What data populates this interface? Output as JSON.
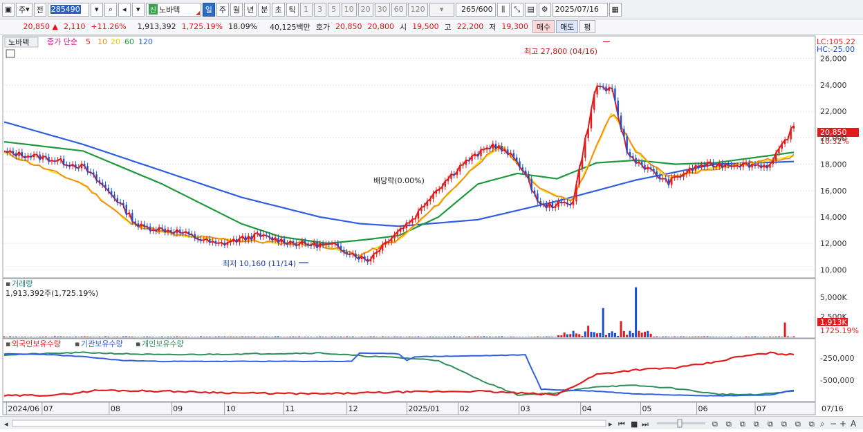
{
  "toolbar": {
    "period_main": "주",
    "prefix": "전",
    "code": "285490",
    "badge": "신",
    "name": "노바텍",
    "tabs": [
      "일",
      "주",
      "월",
      "년",
      "분",
      "초",
      "틱"
    ],
    "active_tab": "일",
    "intervals": [
      "1",
      "3",
      "5",
      "10",
      "20",
      "30",
      "60",
      "120"
    ],
    "count": "265",
    "count_total": "/600",
    "date": "2025/07/16"
  },
  "quote": {
    "price": "20,850",
    "change_arrow": "▲",
    "change": "2,110",
    "change_pct": "+11.26%",
    "volume": "1,913,392",
    "volume_pct": "1,725.19%",
    "turnover": "18.09%",
    "amount": "40,125백만",
    "ask_label": "호가",
    "ask": "20,850",
    "bid": "20,800",
    "open_label": "시",
    "open": "19,500",
    "high_label": "고",
    "high": "22,200",
    "low_label": "저",
    "low": "19,300",
    "buy": "매수",
    "sell": "매도",
    "eval": "평"
  },
  "price_panel": {
    "title": "노바텍",
    "legend_prefix": "종가 단순",
    "ma_labels": [
      "5",
      "10",
      "20",
      "60",
      "120"
    ],
    "ma_colors": [
      "#e21c1c",
      "#f08a1a",
      "#f5e11a",
      "#1e9a3c",
      "#2f5fe0"
    ],
    "lc": "LC:105.22",
    "hc": "HC:-25.00",
    "high_note": "최고 27,800 (04/16)",
    "low_note": "최저 10,160 (11/14)",
    "dividend_note": "배당락(0.00%)",
    "current_tag": "20,850",
    "current_pct": "10.32%",
    "y_ticks": [
      "26,000",
      "24,000",
      "22,000",
      "20,000",
      "18,000",
      "16,000",
      "14,000",
      "12,000",
      "10,000"
    ]
  },
  "volume_panel": {
    "title": "거래량",
    "subtitle": "1,913,392주(1,725.19%)",
    "y_ticks": [
      "5,000K",
      "2,500K"
    ],
    "current_tag": "1,913K",
    "current_pct": "1725.19%"
  },
  "holding_panel": {
    "legend": [
      "외국인보유수량",
      "기관보유수량",
      "개인보유수량"
    ],
    "legend_colors": [
      "#e21c1c",
      "#2f5fe0",
      "#2e8f5a"
    ],
    "y_ticks": [
      "-250,000",
      "-500,000"
    ]
  },
  "x_axis": {
    "labels": [
      "2024/06",
      "07",
      "08",
      "09",
      "10",
      "11",
      "12",
      "2025/01",
      "02",
      "03",
      "04",
      "05",
      "06",
      "07"
    ],
    "end_label": "07/16"
  },
  "chart_data": {
    "type": "line",
    "price_range": [
      9600,
      27400
    ],
    "annotations": {
      "high": {
        "value": 27800,
        "date": "04/16"
      },
      "low": {
        "value": 10160,
        "date": "11/14"
      },
      "last": 20850
    },
    "close_path": [
      [
        0,
        18900
      ],
      [
        0.05,
        18500
      ],
      [
        0.1,
        17800
      ],
      [
        0.14,
        15500
      ],
      [
        0.17,
        13300
      ],
      [
        0.22,
        12900
      ],
      [
        0.27,
        11900
      ],
      [
        0.32,
        12600
      ],
      [
        0.37,
        12000
      ],
      [
        0.42,
        11800
      ],
      [
        0.46,
        10700
      ],
      [
        0.49,
        12500
      ],
      [
        0.52,
        14000
      ],
      [
        0.54,
        15600
      ],
      [
        0.58,
        18000
      ],
      [
        0.62,
        19500
      ],
      [
        0.65,
        18300
      ],
      [
        0.68,
        14800
      ],
      [
        0.72,
        15100
      ],
      [
        0.75,
        24000
      ],
      [
        0.77,
        23500
      ],
      [
        0.79,
        18700
      ],
      [
        0.84,
        16600
      ],
      [
        0.88,
        17900
      ],
      [
        0.93,
        18000
      ],
      [
        0.97,
        17900
      ],
      [
        1.0,
        20850
      ]
    ],
    "ma120_path": [
      [
        0,
        21200
      ],
      [
        0.1,
        19500
      ],
      [
        0.2,
        17500
      ],
      [
        0.3,
        15500
      ],
      [
        0.4,
        14000
      ],
      [
        0.45,
        13500
      ],
      [
        0.5,
        13300
      ],
      [
        0.6,
        13800
      ],
      [
        0.7,
        15200
      ],
      [
        0.8,
        16800
      ],
      [
        0.9,
        18000
      ],
      [
        1.0,
        18200
      ]
    ],
    "ma60_path": [
      [
        0,
        19700
      ],
      [
        0.1,
        19000
      ],
      [
        0.2,
        16500
      ],
      [
        0.3,
        13500
      ],
      [
        0.35,
        12500
      ],
      [
        0.41,
        12000
      ],
      [
        0.46,
        12300
      ],
      [
        0.5,
        12600
      ],
      [
        0.55,
        14000
      ],
      [
        0.6,
        16500
      ],
      [
        0.65,
        17300
      ],
      [
        0.7,
        16900
      ],
      [
        0.75,
        18100
      ],
      [
        0.8,
        18300
      ],
      [
        0.85,
        18000
      ],
      [
        0.9,
        18100
      ],
      [
        0.95,
        18500
      ],
      [
        1.0,
        18900
      ]
    ],
    "ma20_path": [
      [
        0,
        18900
      ],
      [
        0.1,
        16500
      ],
      [
        0.16,
        13500
      ],
      [
        0.22,
        12600
      ],
      [
        0.3,
        12200
      ],
      [
        0.4,
        11900
      ],
      [
        0.45,
        11100
      ],
      [
        0.5,
        12300
      ],
      [
        0.55,
        15000
      ],
      [
        0.6,
        18100
      ],
      [
        0.63,
        19400
      ],
      [
        0.68,
        16000
      ],
      [
        0.72,
        15300
      ],
      [
        0.77,
        22000
      ],
      [
        0.8,
        19000
      ],
      [
        0.84,
        17000
      ],
      [
        0.9,
        17700
      ],
      [
        1.0,
        18600
      ]
    ],
    "volume_spikes": [
      [
        0.71,
        620
      ],
      [
        0.74,
        1500
      ],
      [
        0.76,
        3800
      ],
      [
        0.78,
        2100
      ],
      [
        0.8,
        6500
      ],
      [
        0.99,
        1913
      ]
    ],
    "holdings": {
      "foreign": [
        [
          0,
          -480000
        ],
        [
          0.07,
          -470000
        ],
        [
          0.12,
          -420000
        ],
        [
          0.2,
          -430000
        ],
        [
          0.3,
          -450000
        ],
        [
          0.4,
          -460000
        ],
        [
          0.5,
          -440000
        ],
        [
          0.6,
          -430000
        ],
        [
          0.7,
          -470000
        ],
        [
          0.75,
          -250000
        ],
        [
          0.8,
          -200000
        ],
        [
          0.85,
          -180000
        ],
        [
          0.9,
          -120000
        ],
        [
          0.93,
          -60000
        ],
        [
          0.97,
          -20000
        ],
        [
          1.0,
          -40000
        ]
      ],
      "institution": [
        [
          0,
          -30000
        ],
        [
          0.05,
          -35000
        ],
        [
          0.1,
          -60000
        ],
        [
          0.15,
          -100000
        ],
        [
          0.2,
          -110000
        ],
        [
          0.3,
          -110000
        ],
        [
          0.4,
          -110000
        ],
        [
          0.44,
          -110000
        ],
        [
          0.45,
          -20000
        ],
        [
          0.5,
          -30000
        ],
        [
          0.51,
          -100000
        ],
        [
          0.52,
          -60000
        ],
        [
          0.6,
          -50000
        ],
        [
          0.66,
          -40000
        ],
        [
          0.68,
          -410000
        ],
        [
          0.75,
          -430000
        ],
        [
          0.8,
          -460000
        ],
        [
          0.9,
          -480000
        ],
        [
          0.97,
          -470000
        ],
        [
          1.0,
          -420000
        ]
      ],
      "individual": [
        [
          0,
          -40000
        ],
        [
          0.1,
          -15000
        ],
        [
          0.2,
          -40000
        ],
        [
          0.3,
          -30000
        ],
        [
          0.4,
          -20000
        ],
        [
          0.45,
          -50000
        ],
        [
          0.5,
          -70000
        ],
        [
          0.55,
          -100000
        ],
        [
          0.6,
          -300000
        ],
        [
          0.65,
          -470000
        ],
        [
          0.7,
          -450000
        ],
        [
          0.75,
          -380000
        ],
        [
          0.8,
          -370000
        ],
        [
          0.85,
          -400000
        ],
        [
          0.9,
          -460000
        ],
        [
          0.95,
          -470000
        ],
        [
          1.0,
          -430000
        ]
      ]
    }
  }
}
